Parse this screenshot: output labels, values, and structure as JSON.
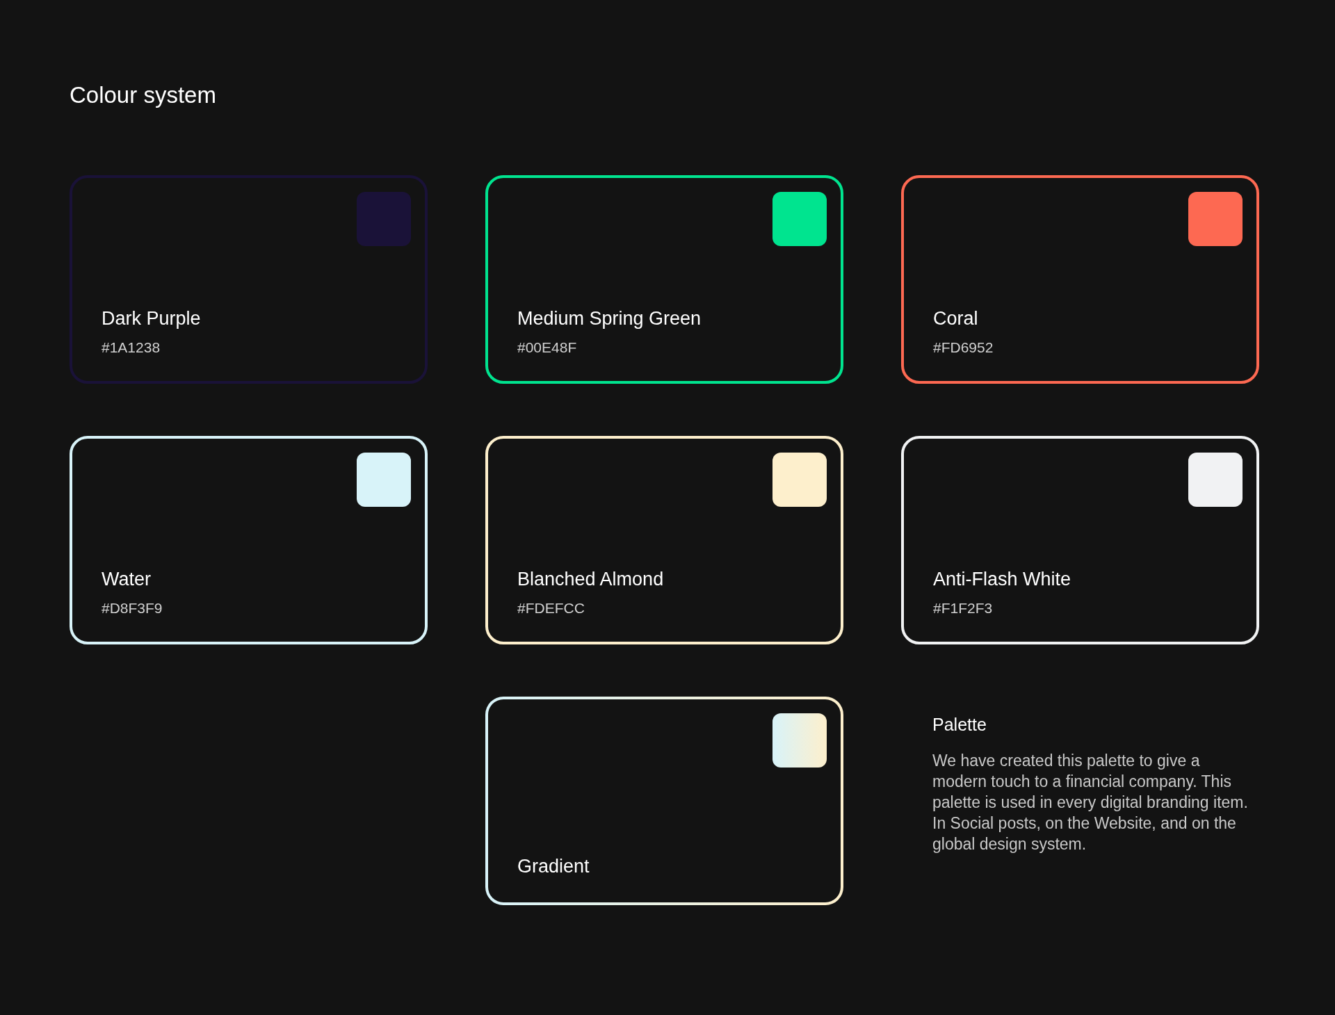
{
  "title": "Colour system",
  "cards": [
    {
      "kind": "solid",
      "name": "Dark Purple",
      "hex": "#1A1238",
      "color": "#1a1238"
    },
    {
      "kind": "solid",
      "name": "Medium Spring Green",
      "hex": "#00E48F",
      "color": "#00e48f"
    },
    {
      "kind": "solid",
      "name": "Coral",
      "hex": "#FD6952",
      "color": "#fd6952"
    },
    {
      "kind": "solid",
      "name": "Water",
      "hex": "#D8F3F9",
      "color": "#d8f3f9"
    },
    {
      "kind": "solid",
      "name": "Blanched Almond",
      "hex": "#FDEFCC",
      "color": "#fdefcc"
    },
    {
      "kind": "solid",
      "name": "Anti-Flash White",
      "hex": "#F1F2F3",
      "color": "#f1f2f3"
    },
    {
      "kind": "gradient",
      "name": "Gradient",
      "stops": [
        {
          "color": "#d8f3f9"
        },
        {
          "color": "#fdefcc"
        }
      ]
    }
  ],
  "note": {
    "heading": "Palette",
    "text": "We have created this palette to give a modern touch to a financial company. This palette is used in every digital branding item. In Social posts, on the Website, and on the global design system."
  }
}
